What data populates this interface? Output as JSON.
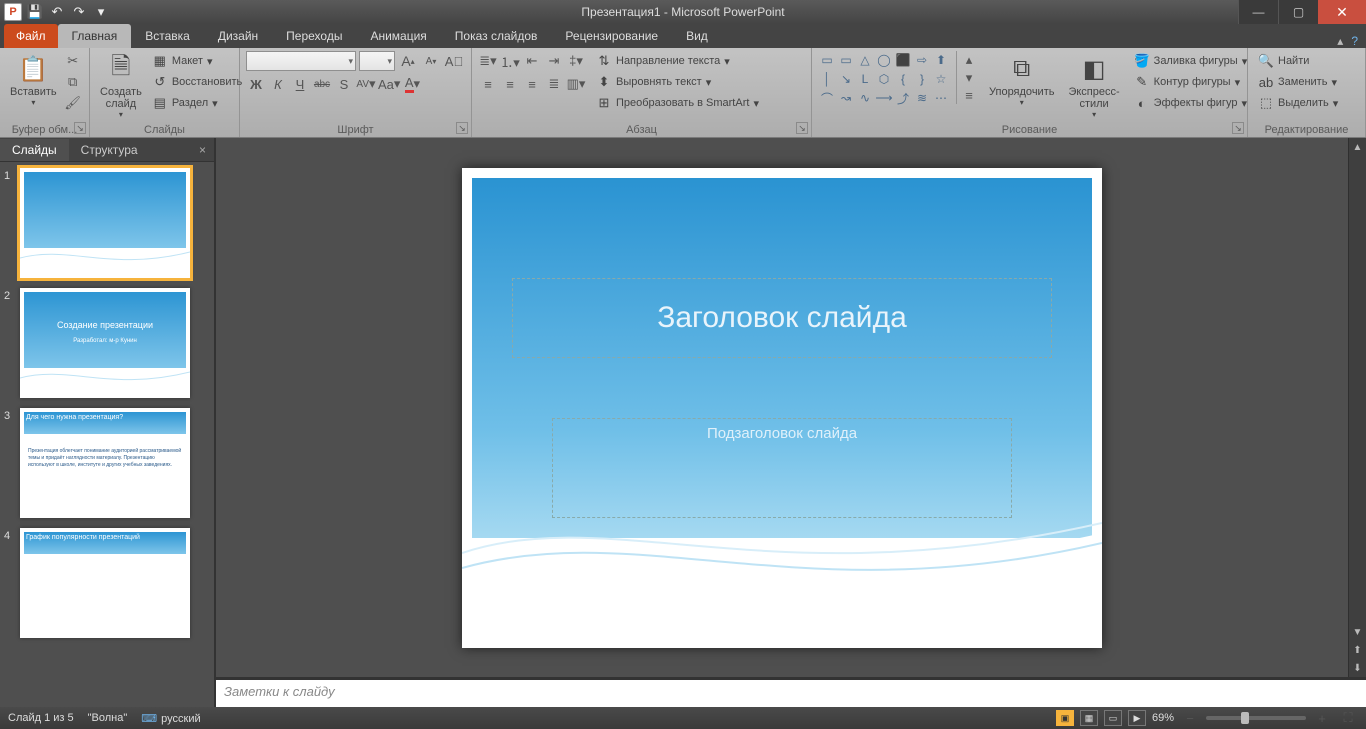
{
  "title": "Презентация1 - Microsoft PowerPoint",
  "qat": {
    "save": "💾",
    "undo": "↶",
    "redo": "↷"
  },
  "tabs": {
    "file": "Файл",
    "items": [
      "Главная",
      "Вставка",
      "Дизайн",
      "Переходы",
      "Анимация",
      "Показ слайдов",
      "Рецензирование",
      "Вид"
    ],
    "active": 0
  },
  "ribbon": {
    "clipboard": {
      "label": "Буфер обм...",
      "paste": "Вставить",
      "cut": "✂",
      "copy": "⧉",
      "painter": "🖌"
    },
    "slides": {
      "label": "Слайды",
      "new_slide": "Создать\nслайд",
      "layout": "Макет",
      "reset": "Восстановить",
      "section": "Раздел"
    },
    "font": {
      "label": "Шрифт",
      "family": "",
      "size": "",
      "bold": "Ж",
      "italic": "К",
      "underline": "Ч",
      "strike": "abc",
      "shadow": "S",
      "spacing": "AV",
      "case": "Aa",
      "clear": "A",
      "grow": "A",
      "shrink": "A",
      "color": "A"
    },
    "paragraph": {
      "label": "Абзац",
      "text_dir": "Направление текста",
      "align_text": "Выровнять текст",
      "smartart": "Преобразовать в SmartArt"
    },
    "drawing": {
      "label": "Рисование",
      "arrange": "Упорядочить",
      "quick_styles": "Экспресс-стили",
      "fill": "Заливка фигуры",
      "outline": "Контур фигуры",
      "effects": "Эффекты фигур"
    },
    "editing": {
      "label": "Редактирование",
      "find": "Найти",
      "replace": "Заменить",
      "select": "Выделить"
    }
  },
  "side_tabs": {
    "slides": "Слайды",
    "outline": "Структура"
  },
  "thumbs": [
    {
      "n": "1",
      "selected": true
    },
    {
      "n": "2",
      "title": "Создание презентации",
      "sub": "Разработал: м-р Кунин"
    },
    {
      "n": "3",
      "header": "Для чего нужна презентация?",
      "body": "Презентация облегчает понимание аудиторией рассматриваемой темы и придаёт наглядности материалу.\nПрезентацию используют в школе, институте и других учебных заведениях."
    },
    {
      "n": "4",
      "header": "График популярности презентаций"
    }
  ],
  "slide": {
    "title": "Заголовок слайда",
    "subtitle": "Подзаголовок слайда"
  },
  "notes_placeholder": "Заметки к слайду",
  "status": {
    "slide_of": "Слайд 1 из 5",
    "theme": "\"Волна\"",
    "lang": "русский",
    "zoom": "69%"
  },
  "shapes_row1": [
    "▭",
    "▭",
    "△",
    "◯",
    "⬛",
    "⇨",
    "⬆"
  ],
  "shapes_row2": [
    "│",
    "↘",
    "L",
    "⬡",
    "{",
    "}",
    "☆"
  ],
  "shapes_row3": [
    "⌒",
    "↝",
    "∿",
    "⟶",
    "⤴",
    "≋",
    "⋯"
  ]
}
